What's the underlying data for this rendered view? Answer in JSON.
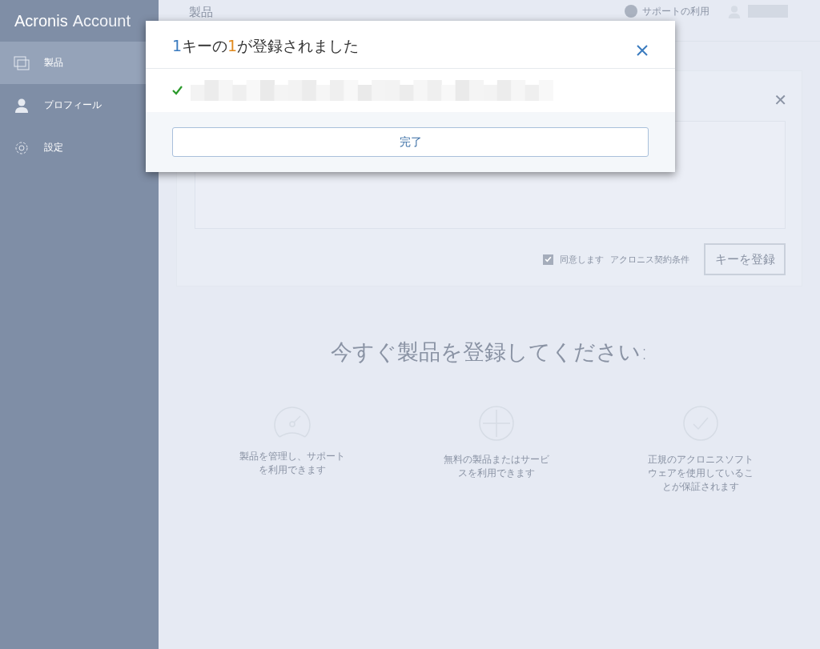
{
  "sidebar": {
    "logo": {
      "brand": "Acronis",
      "product": "Account"
    },
    "items": [
      {
        "label": "製品",
        "selected": true
      },
      {
        "label": "プロフィール",
        "selected": false
      },
      {
        "label": "設定",
        "selected": false
      }
    ]
  },
  "header": {
    "title": "製品",
    "support": "サポートの利用"
  },
  "register_card": {
    "close": "✕",
    "agree_checked": true,
    "agree_label": "同意します",
    "terms_link": "アクロニス契約条件",
    "register_button": "キーを登録"
  },
  "promo": {
    "heading": "今すぐ製品を登録してください:",
    "features": [
      {
        "text": "製品を管理し、サポートを利用できます"
      },
      {
        "text": "無料の製品またはサービスを利用できます"
      },
      {
        "text": "正規のアクロニスソフトウェアを使用していることが保証されます"
      }
    ]
  },
  "dialog": {
    "title": {
      "count": "1",
      "middle": "キーの",
      "registered": "1",
      "suffix": "が登録されました"
    },
    "done_button": "完了"
  }
}
